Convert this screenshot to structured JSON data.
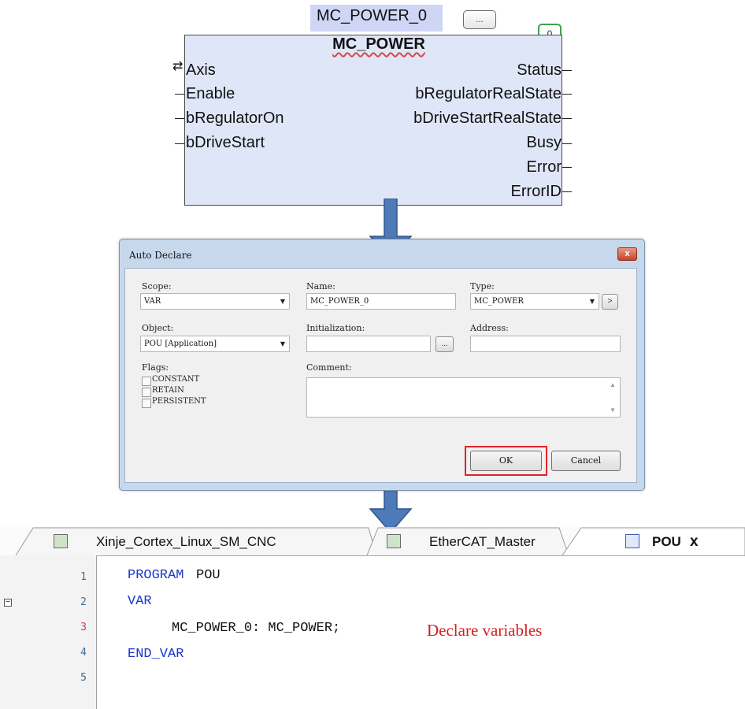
{
  "function_block": {
    "instance_name": "MC_POWER_0",
    "ellipsis_label": "...",
    "counter": "0",
    "type_name": "MC_POWER",
    "inputs": [
      "Axis",
      "Enable",
      "bRegulatorOn",
      "bDriveStart"
    ],
    "outputs": [
      "Status",
      "bRegulatorRealState",
      "bDriveStartRealState",
      "Busy",
      "Error",
      "ErrorID"
    ]
  },
  "dialog": {
    "title": "Auto Declare",
    "close_label": "x",
    "scope_label": "Scope:",
    "scope_value": "VAR",
    "name_label": "Name:",
    "name_value": "MC_POWER_0",
    "type_label": "Type:",
    "type_value": "MC_POWER",
    "type_button": ">",
    "object_label": "Object:",
    "object_value": "POU [Application]",
    "initialization_label": "Initialization:",
    "initialization_value": "",
    "init_button": "...",
    "address_label": "Address:",
    "address_value": "",
    "flags_label": "Flags:",
    "flags": [
      "CONSTANT",
      "RETAIN",
      "PERSISTENT"
    ],
    "comment_label": "Comment:",
    "comment_value": "",
    "ok_label": "OK",
    "cancel_label": "Cancel"
  },
  "editor": {
    "tabs": [
      {
        "label": "Xinje_Cortex_Linux_SM_CNC"
      },
      {
        "label": "EtherCAT_Master"
      },
      {
        "label": "POU",
        "close": "x"
      }
    ],
    "line_numbers": [
      "1",
      "2",
      "3",
      "4",
      "5"
    ],
    "code": {
      "line1_kw": "PROGRAM",
      "line1_id": "POU",
      "line2_kw": "VAR",
      "line3": "MC_POWER_0: MC_POWER;",
      "line4_kw": "END_VAR"
    },
    "annotation": "Declare variables"
  },
  "colors": {
    "arrow": "#4f7ab8",
    "keyword": "#1a36c7",
    "annotation": "#d41e1e",
    "highlight": "#e0232b"
  }
}
